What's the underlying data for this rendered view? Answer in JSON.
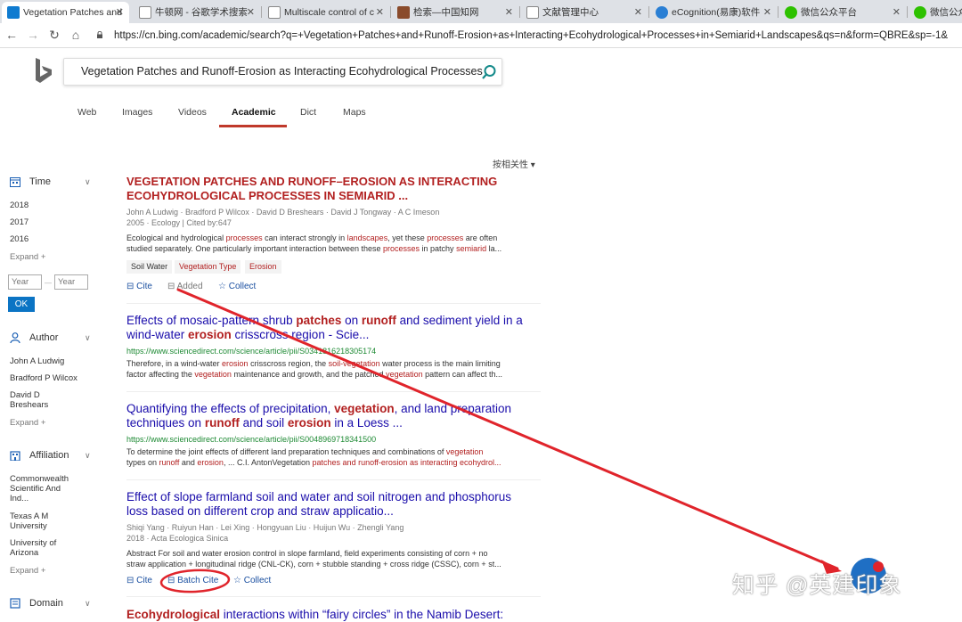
{
  "tabs": [
    {
      "label": "Vegetation Patches and",
      "icon": "bing-icon",
      "color": "#0f7bd0"
    },
    {
      "label": "牛顿网 - 谷歌学术搜索",
      "icon": "page-icon",
      "color": "#888888"
    },
    {
      "label": "Multiscale control of c",
      "icon": "page-icon",
      "color": "#888888"
    },
    {
      "label": "检索—中国知网",
      "icon": "cnki-icon",
      "color": "#8a4b2b"
    },
    {
      "label": "文献管理中心",
      "icon": "page-icon",
      "color": "#888888"
    },
    {
      "label": "eCognition(易康)软件",
      "icon": "ecognition-icon",
      "color": "#2a7fd4"
    },
    {
      "label": "微信公众平台",
      "icon": "wechat-icon",
      "color": "#2dc100"
    },
    {
      "label": "微信公众",
      "icon": "wechat-icon",
      "color": "#2dc100"
    }
  ],
  "address": {
    "url": "https://cn.bing.com/academic/search?q=+Vegetation+Patches+and+Runoff-Erosion+as+Interacting+Ecohydrological+Processes+in+Semiarid+Landscapes&qs=n&form=QBRE&sp=-1&"
  },
  "search": {
    "query": "Vegetation Patches and Runoff-Erosion as Interacting Ecohydrological Processes"
  },
  "nav_tabs": [
    "Web",
    "Images",
    "Videos",
    "Academic",
    "Dict",
    "Maps"
  ],
  "sort_label": "按相关性 ▾",
  "sidebar": {
    "time": {
      "label": "Time",
      "items": [
        "2018",
        "2017",
        "2016"
      ],
      "expand": "Expand +",
      "year_from": "Year",
      "year_to": "Year",
      "ok": "OK",
      "dash": "—"
    },
    "author": {
      "label": "Author",
      "items": [
        "John A Ludwig",
        "Bradford P Wilcox",
        "David D Breshears"
      ],
      "expand": "Expand +"
    },
    "affiliation": {
      "label": "Affiliation",
      "items": [
        "Commonwealth Scientific And Ind...",
        "Texas A M University",
        "University of Arizona"
      ],
      "expand": "Expand +"
    },
    "domain": {
      "label": "Domain"
    }
  },
  "results": [
    {
      "title_line1": "VEGETATION PATCHES AND RUNOFF–EROSION AS INTERACTING",
      "title_line2": "ECOHYDROLOGICAL PROCESSES IN SEMIARID ...",
      "authors": "John A Ludwig · Bradford P Wilcox · David D Breshears · David J Tongway · A C Imeson",
      "meta": "2005 · Ecology | Cited by:647",
      "snippet1": "Ecological and hydrological processes can interact strongly in landscapes, yet these processes are often",
      "snippet2": "studied separately. One particularly important interaction between these processes in patchy semiarid la...",
      "tags": [
        "Soil Water",
        "Vegetation Type",
        "Erosion"
      ],
      "cite": "Cite",
      "added": "Added",
      "collect": "Collect"
    },
    {
      "title_line1": "Effects of mosaic-pattern shrub patches on runoff and sediment yield in a",
      "title_line2": "wind-water erosion crisscross region - Scie...",
      "url": "https://www.sciencedirect.com/science/article/pii/S0341816218305174",
      "snippet1": "Therefore, in a wind-water erosion crisscross region, the soil-vegetation water process is the main limiting",
      "snippet2": "factor affecting the vegetation maintenance and growth, and the patched vegetation pattern can affect th..."
    },
    {
      "title_line1": "Quantifying the effects of precipitation, vegetation, and land preparation",
      "title_line2": "techniques on runoff and soil erosion in a Loess ...",
      "url": "https://www.sciencedirect.com/science/article/pii/S0048969718341500",
      "snippet1": "To determine the joint effects of different land preparation techniques and combinations of vegetation",
      "snippet2": "types on runoff and erosion, ... C.I. AntonVegetation patches and runoff-erosion as interacting ecohydrol..."
    },
    {
      "title_line1": "Effect of slope farmland soil and water and soil nitrogen and phosphorus",
      "title_line2": "loss based on different crop and straw applicatio...",
      "authors": "Shiqi Yang · Ruiyun Han · Lei Xing · Hongyuan Liu · Huijun Wu · Zhengli Yang",
      "meta": "2018 · Acta Ecologica Sinica",
      "snippet1": "Abstract For soil and water erosion control in slope farmland, field experiments consisting of corn + no",
      "snippet2": "straw application + longitudinal ridge (CNL-CK), corn + stubble standing + cross ridge (CSSC), corn + st...",
      "cite": "Cite",
      "batch_cite": "Batch Cite",
      "collect": "Collect"
    },
    {
      "title_line1": "Ecohydrological interactions within “fairy circles” in the Namib Desert:"
    }
  ],
  "watermark": "知乎 @英建印象",
  "colors": {
    "accent": "#c0392b",
    "link": "#1a0dab",
    "url": "#1e8a34",
    "annotation": "#e0242b"
  }
}
